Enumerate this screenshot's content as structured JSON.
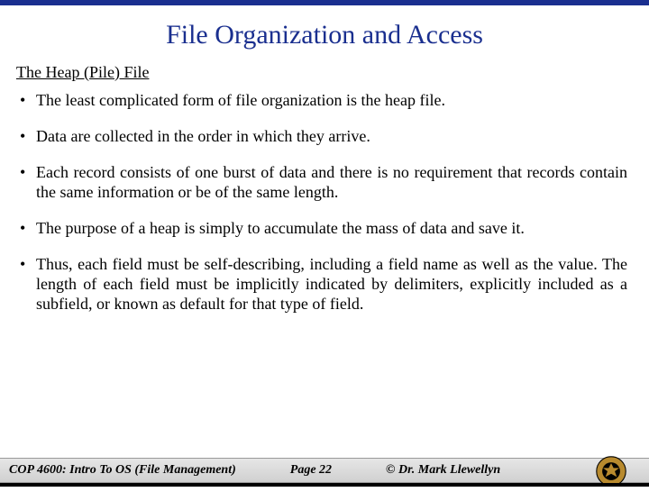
{
  "title": "File Organization and Access",
  "section_heading": "The Heap (Pile) File",
  "bullets": [
    "The least complicated form of file organization is the heap file.",
    "Data are collected in the order in which they arrive.",
    "Each record consists of one burst of data and there is no requirement that records contain the same information or be of the same length.",
    "The purpose of a heap is simply to accumulate the mass of data and save it.",
    "Thus, each field must be self-describing, including a field name as well as the value. The length of each field must be implicitly indicated by delimiters, explicitly included as a subfield, or known as default for that type of field."
  ],
  "footer": {
    "course": "COP 4600: Intro To OS  (File Management)",
    "page": "Page 22",
    "copyright": "© Dr. Mark Llewellyn"
  },
  "colors": {
    "title": "#1a2f8f",
    "logo_gold": "#b88a2e"
  }
}
